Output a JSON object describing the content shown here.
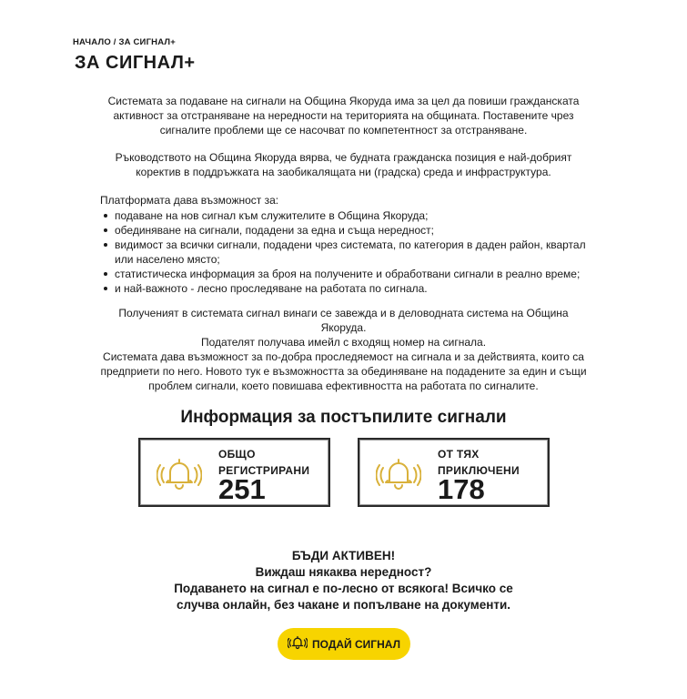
{
  "breadcrumb": {
    "home": "НАЧАЛО",
    "separator": "/",
    "current": "ЗА СИГНАЛ+"
  },
  "page_title": "ЗА СИГНАЛ+",
  "intro": {
    "paragraph1": "Системата за подаване на сигнали на Община Якоруда има за цел да повиши гражданската активност за отстраняване на нередности на територията на общината. Поставените чрез сигналите проблеми ще се насочват по компетентност за отстраняване.",
    "paragraph2": "Ръководството на Община Якоруда вярва, че будната гражданска позиция е най-добрият коректив в поддръжката на заобикалящата ни (градска) среда и инфраструктура."
  },
  "features": {
    "intro": "Платформата дава възможност за:",
    "items": [
      "подаване на нов сигнал към служителите в Община Якоруда;",
      "обединяване на сигнали, подадени за една и съща нередност;",
      "видимост за всички сигнали, подадени чрез системата, по категория в даден район, квартал или населено място;",
      "статистическа информация за броя на получените и обработвани сигнали в реално време;",
      "и най-важното - лесно проследяване на работата по сигнала."
    ]
  },
  "process": {
    "line1": "Полученият в системата сигнал винаги се завежда и в деловодната система на Община Якоруда.",
    "line2": "Подателят получава имейл с входящ номер на сигнала.",
    "line3": "Системата дава възможност за по-добра проследяемост на сигнала и за действията, които са предприети по него. Новото тук е възможността за обединяване на подадените за един и същи проблем сигнали, което повишава ефективността на работата по сигналите."
  },
  "stats": {
    "heading": "Информация за постъпилите сигнали",
    "cards": [
      {
        "label_line1": "ОБЩО",
        "label_line2": "РЕГИСТРИРАНИ",
        "value": "251",
        "icon": "bell-icon"
      },
      {
        "label_line1": "ОТ ТЯХ",
        "label_line2": "ПРИКЛЮЧЕНИ",
        "value": "178",
        "icon": "bell-icon"
      }
    ]
  },
  "cta": {
    "line1": "БЪДИ АКТИВЕН!",
    "line2": "Виждаш някаква нередност?",
    "line3": "Подаването на сигнал е по-лесно от всякога! Всичко се",
    "line4": "случва онлайн, без чакане и попълване на документи.",
    "button_label": "ПОДАЙ СИГНАЛ",
    "button_icon": "bell-icon"
  },
  "colors": {
    "accent": "#f7d400",
    "bell": "#d9b13a",
    "text": "#1a1a1a"
  }
}
